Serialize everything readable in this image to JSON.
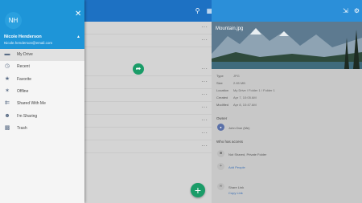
{
  "drawer": {
    "avatar_initials": "NH",
    "user_name": "Nicole Henderson",
    "user_email": "Nicole.henderson@email.com",
    "items": [
      {
        "label": "My Drive",
        "icon": "folder-icon",
        "active": true
      },
      {
        "label": "Recent",
        "icon": "clock-icon",
        "active": false
      },
      {
        "label": "Favorite",
        "icon": "star-icon",
        "active": false
      },
      {
        "label": "Offline",
        "icon": "offline-icon",
        "active": false
      },
      {
        "label": "Shared With Me",
        "icon": "shared-icon",
        "active": false
      },
      {
        "label": "I'm Sharing",
        "icon": "people-icon",
        "active": false
      },
      {
        "label": "Trash",
        "icon": "trash-icon",
        "active": false
      }
    ]
  },
  "main": {
    "more_label": "···",
    "fab_label": "+"
  },
  "detail": {
    "title": "Mountain.jpg",
    "properties": [
      {
        "label": "Type",
        "value": "JPG"
      },
      {
        "label": "Size",
        "value": "2.65 MB"
      },
      {
        "label": "Location",
        "value": "My Drive / Folder 1 / Folder 1"
      },
      {
        "label": "Created",
        "value": "Apr 7, 10:05 AM"
      },
      {
        "label": "Modified",
        "value": "Apr 8, 10:47 AM"
      }
    ],
    "owner_title": "Owner",
    "owner_name": "John Doe (Me)",
    "access_title": "Who has access",
    "access_status": "Not Shared, Private Folder",
    "add_people": "Add People",
    "share_link_title": "Share Link",
    "copy_link": "Copy Link"
  }
}
